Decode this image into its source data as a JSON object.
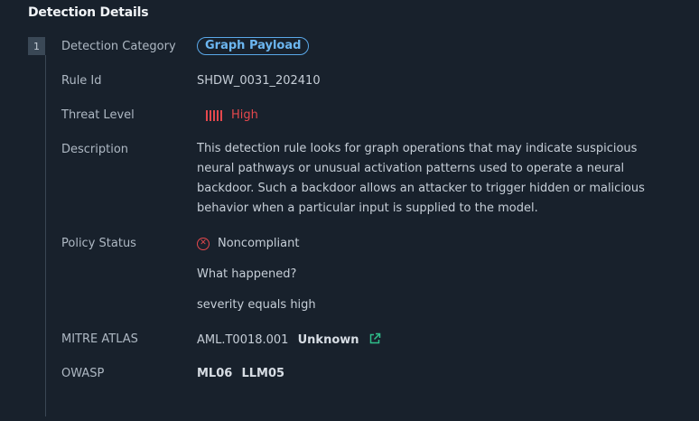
{
  "section": {
    "title": "Detection Details"
  },
  "item": {
    "index": "1"
  },
  "labels": {
    "category": "Detection Category",
    "rule_id": "Rule Id",
    "threat": "Threat Level",
    "description": "Description",
    "policy": "Policy Status",
    "mitre": "MITRE ATLAS",
    "owasp": "OWASP"
  },
  "values": {
    "category": "Graph Payload",
    "rule_id": "SHDW_0031_202410",
    "threat": "High",
    "threat_bars": 5,
    "description": "This detection rule looks for graph operations that may indicate suspicious neural pathways or unusual activation patterns used to operate a neural backdoor. Such a backdoor allows an attacker to trigger hidden or malicious behavior when a particular input is supplied to the model.",
    "policy_status": "Noncompliant",
    "what_happened": "What happened?",
    "severity_text": "severity equals high",
    "mitre_id": "AML.T0018.001",
    "mitre_name": "Unknown",
    "owasp_1": "ML06",
    "owasp_2": "LLM05"
  },
  "icons": {
    "threat": "severity-bars-icon",
    "policy": "circle-x-icon",
    "mitre_link": "external-link-icon"
  },
  "colors": {
    "background": "#18212c",
    "accent_blue": "#6cb6f0",
    "danger": "#e5484d",
    "link_green": "#2fbf8a"
  }
}
